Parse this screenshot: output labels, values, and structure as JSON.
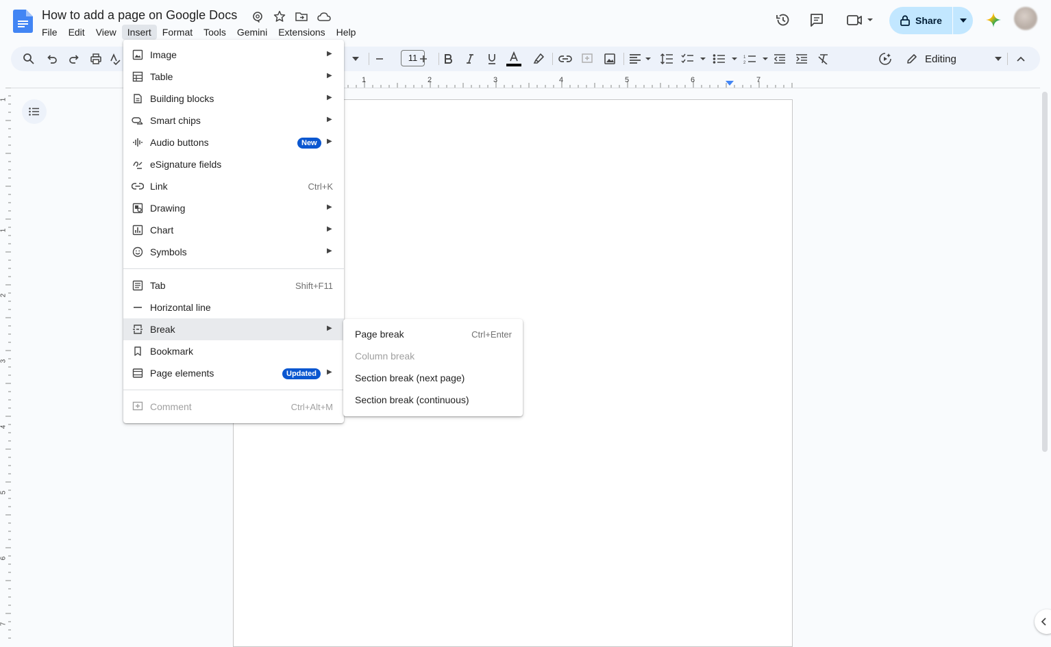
{
  "document": {
    "title": "How to add a page on Google Docs"
  },
  "menubar": {
    "items": [
      "File",
      "Edit",
      "View",
      "Insert",
      "Format",
      "Tools",
      "Gemini",
      "Extensions",
      "Help"
    ],
    "active": "Insert"
  },
  "header": {
    "share_label": "Share"
  },
  "toolbar": {
    "font_size": "11",
    "mode_label": "Editing"
  },
  "ruler": {
    "numbers": [
      "1",
      "2",
      "3",
      "4",
      "5",
      "6",
      "7"
    ]
  },
  "vruler": {
    "numbers": [
      "1",
      "1",
      "2",
      "3",
      "4",
      "5",
      "6",
      "7"
    ]
  },
  "insert_menu": {
    "items": [
      {
        "label": "Image",
        "icon": "image-icon",
        "submenu": true
      },
      {
        "label": "Table",
        "icon": "table-icon",
        "submenu": true
      },
      {
        "label": "Building blocks",
        "icon": "building-blocks-icon",
        "submenu": true
      },
      {
        "label": "Smart chips",
        "icon": "smart-chips-icon",
        "submenu": true
      },
      {
        "label": "Audio buttons",
        "icon": "audio-icon",
        "submenu": true,
        "badge": "New"
      },
      {
        "label": "eSignature fields",
        "icon": "esignature-icon",
        "submenu": false
      },
      {
        "label": "Link",
        "icon": "link-icon",
        "shortcut": "Ctrl+K"
      },
      {
        "label": "Drawing",
        "icon": "drawing-icon",
        "submenu": true
      },
      {
        "label": "Chart",
        "icon": "chart-icon",
        "submenu": true
      },
      {
        "label": "Symbols",
        "icon": "symbols-icon",
        "submenu": true
      },
      {
        "label": "Tab",
        "icon": "tab-icon",
        "shortcut": "Shift+F11"
      },
      {
        "label": "Horizontal line",
        "icon": "horizontal-line-icon"
      },
      {
        "label": "Break",
        "icon": "break-icon",
        "submenu": true,
        "highlighted": true
      },
      {
        "label": "Bookmark",
        "icon": "bookmark-icon"
      },
      {
        "label": "Page elements",
        "icon": "page-elements-icon",
        "submenu": true,
        "badge": "Updated"
      },
      {
        "label": "Comment",
        "icon": "comment-icon",
        "shortcut": "Ctrl+Alt+M",
        "disabled": true
      }
    ]
  },
  "break_submenu": {
    "items": [
      {
        "label": "Page break",
        "shortcut": "Ctrl+Enter"
      },
      {
        "label": "Column break",
        "disabled": true
      },
      {
        "label": "Section break (next page)"
      },
      {
        "label": "Section break (continuous)"
      }
    ]
  },
  "colors": {
    "share_bg": "#c2e7ff",
    "badge_bg": "#0b57d0",
    "toolbar_bg": "#edf2fa",
    "menu_active": "#e1e5ea"
  }
}
